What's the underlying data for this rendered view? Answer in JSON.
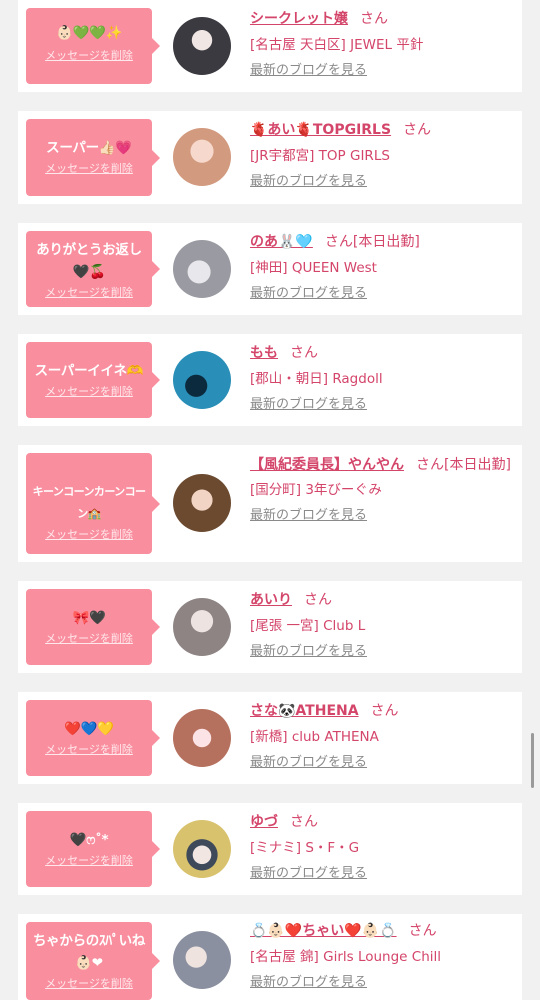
{
  "cards": [
    {
      "message": "👶🏻💚💚✨",
      "delete_label": "メッセージを削除",
      "name": "シークレット嬢",
      "san": "さん",
      "extra": "",
      "shop": "[名古屋 天白区] JEWEL 平針",
      "blog": "最新のブログを見る",
      "avatar_color": "#2a2a2e"
    },
    {
      "message": "スーパー👍🏻💗",
      "delete_label": "メッセージを削除",
      "name": "🫀あい🫀TOPGIRLS",
      "san": "さん",
      "extra": "",
      "shop": "[JR宇都宮] TOP GIRLS",
      "blog": "最新のブログを見る",
      "avatar_color": "#e9b9a4"
    },
    {
      "message": "ありがとうお返し🖤🍒",
      "delete_label": "メッセージを削除",
      "name": "のあ🐰🩵",
      "san": "さん",
      "extra": "[本日出勤]",
      "shop": "[神田] QUEEN West",
      "blog": "最新のブログを見る",
      "avatar_color": "#c6c6cc"
    },
    {
      "message": "スーパーイイネ🫶",
      "delete_label": "メッセージを削除",
      "name": "もも",
      "san": "さん",
      "extra": "",
      "shop": "[郡山・朝日] Ragdoll",
      "blog": "最新のブログを見る",
      "avatar_color": "#1c6f93"
    },
    {
      "message": "キーンコーンカーンコーン🏫",
      "delete_label": "メッセージを削除",
      "name": "【風紀委員長】やんやん",
      "san": "さん",
      "extra": "[本日出勤]",
      "shop": "[国分町] 3年びーぐみ",
      "blog": "最新のブログを見る",
      "avatar_color": "#7a5a40"
    },
    {
      "message": "🎀🖤",
      "delete_label": "メッセージを削除",
      "name": "あいり",
      "san": "さん",
      "extra": "",
      "shop": "[尾張 一宮] Club L",
      "blog": "最新のブログを見る",
      "avatar_color": "#b8b0b0"
    },
    {
      "message": "❤️💙💛",
      "delete_label": "メッセージを削除",
      "name": "さな🐼ATHENA",
      "san": "さん",
      "extra": "",
      "shop": "[新橋] club ATHENA",
      "blog": "最新のブログを見る",
      "avatar_color": "#c9867a"
    },
    {
      "message": "🖤ෆ˚*",
      "delete_label": "メッセージを削除",
      "name": "ゆづ",
      "san": "さん",
      "extra": "",
      "shop": "[ミナミ] S・F・G",
      "blog": "最新のブログを見る",
      "avatar_color": "#6f9ab4"
    },
    {
      "message": "ちゃからのｽﾊﾟいね👶🏻❤︎",
      "delete_label": "メッセージを削除",
      "name": "💍👶🏻❤️ちゃい❤️👶🏻💍",
      "san": "さん",
      "extra": "",
      "shop": "[名古屋 錦] Girls Lounge Chill",
      "blog": "最新のブログを見る",
      "avatar_color": "#a4aab8"
    }
  ]
}
